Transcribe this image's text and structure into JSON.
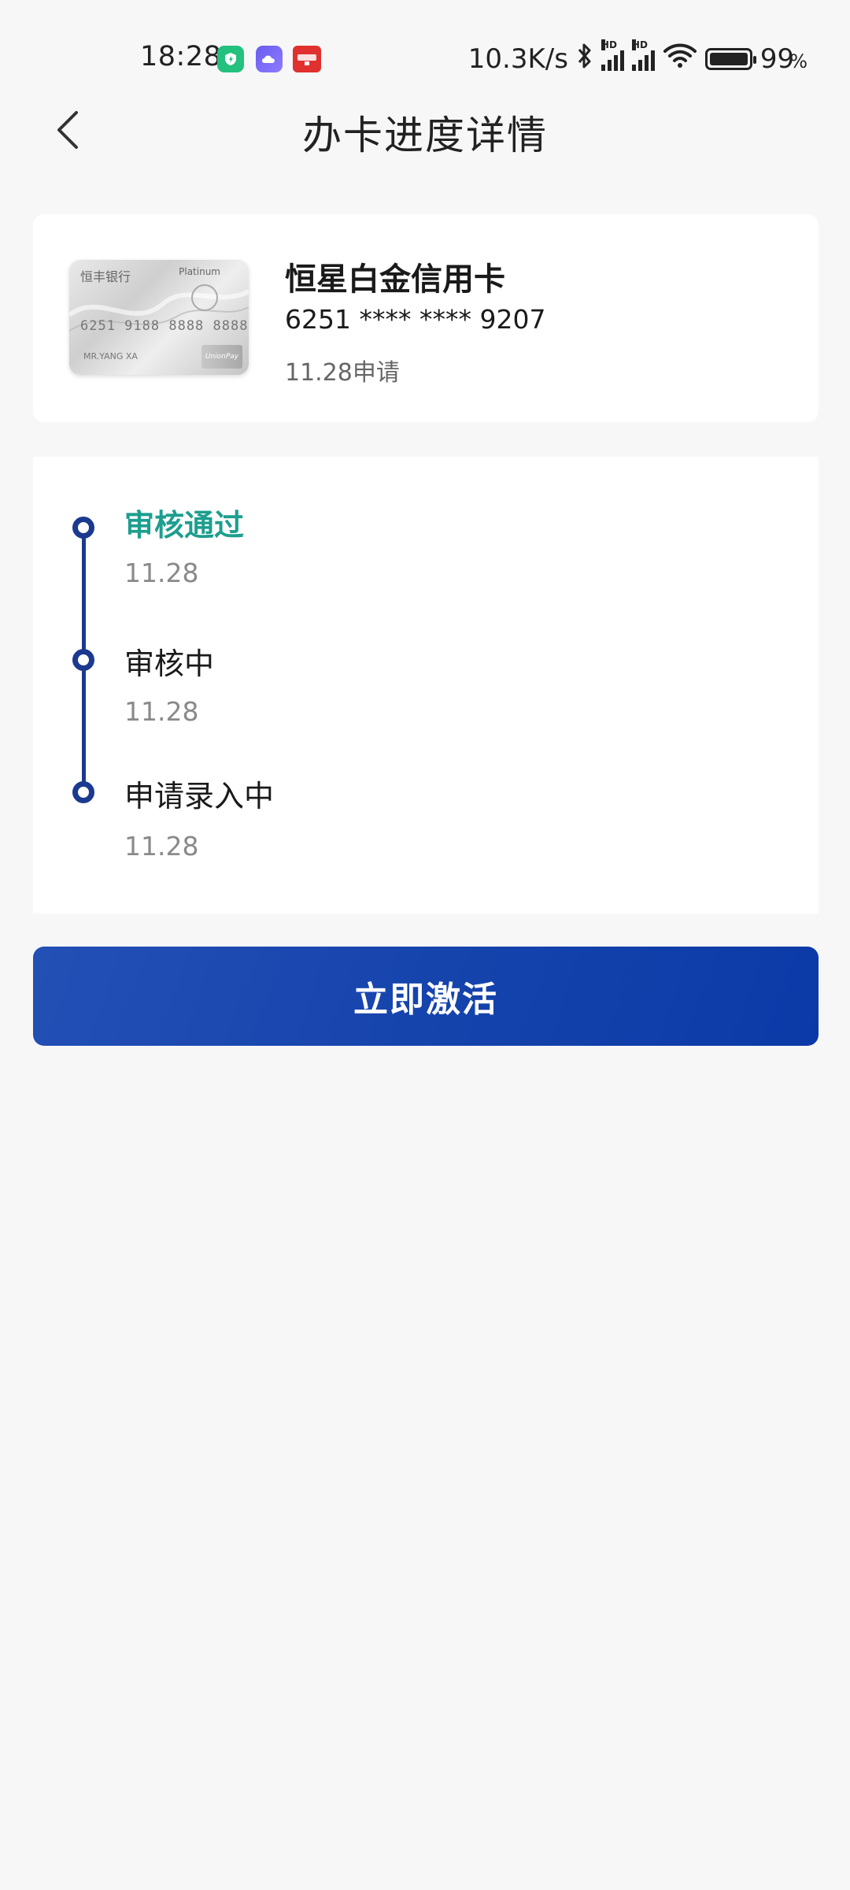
{
  "status_bar": {
    "time": "18:28",
    "network_speed": "10.3K/s",
    "battery_percent": "99",
    "battery_unit": "%",
    "signal_label": "HD",
    "app_icons": [
      "shield-app-icon",
      "cloud-app-icon",
      "yunshanfu-app-icon"
    ]
  },
  "header": {
    "title": "办卡进度详情",
    "back_icon": "chevron-left-icon"
  },
  "card": {
    "name": "恒星白金信用卡",
    "number": "6251 **** **** 9207",
    "apply_date": "11.28申请",
    "image": {
      "bank_text": "恒丰银行",
      "tier_text": "Platinum",
      "number_text": "6251 9188 8888 8888",
      "holder_text": "MR.YANG XA",
      "network_text": "UnionPay"
    }
  },
  "timeline": {
    "items": [
      {
        "title": "审核通过",
        "date": "11.28",
        "status": "passed"
      },
      {
        "title": "审核中",
        "date": "11.28",
        "status": "done"
      },
      {
        "title": "申请录入中",
        "date": "11.28",
        "status": "done"
      }
    ]
  },
  "actions": {
    "activate_label": "立即激活"
  },
  "colors": {
    "accent_blue": "#1644ad",
    "timeline_blue": "#1b3a8f",
    "passed_green": "#1d9e8e",
    "background": "#f7f7f7"
  }
}
